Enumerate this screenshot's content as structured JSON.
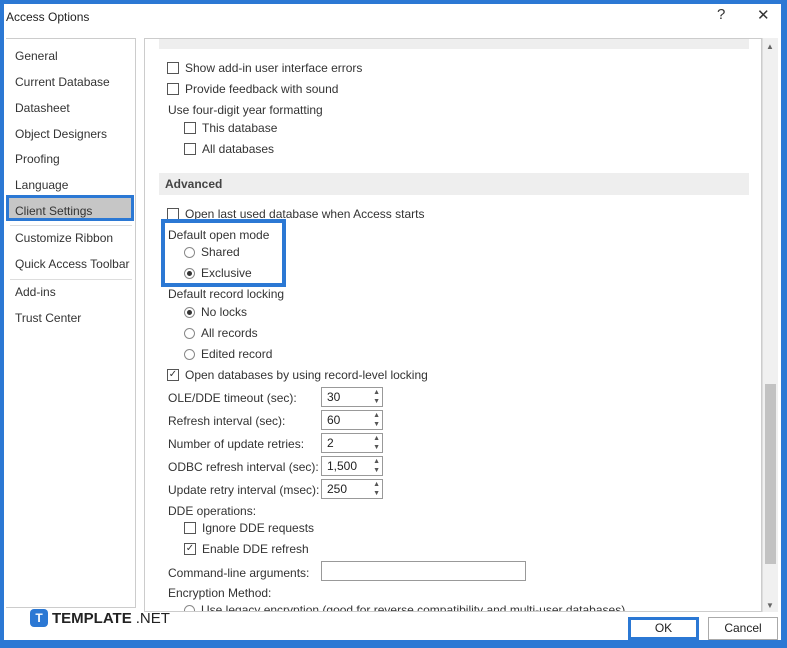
{
  "window": {
    "title": "Access Options",
    "help": "?",
    "close": "✕"
  },
  "sidebar": {
    "items": [
      "General",
      "Current Database",
      "Datasheet",
      "Object Designers",
      "Proofing",
      "Language",
      "Client Settings",
      "Customize Ribbon",
      "Quick Access Toolbar",
      "Add-ins",
      "Trust Center"
    ],
    "selected": "Client Settings"
  },
  "general": {
    "show_addin_errors": "Show add-in user interface errors",
    "feedback_sound": "Provide feedback with sound",
    "four_digit": "Use four-digit year formatting",
    "this_db": "This database",
    "all_db": "All databases"
  },
  "advanced": {
    "header": "Advanced",
    "open_last": "Open last used database when Access starts",
    "open_mode_label": "Default open mode",
    "shared": "Shared",
    "exclusive": "Exclusive",
    "open_mode_selected": "Exclusive",
    "record_locking_label": "Default record locking",
    "no_locks": "No locks",
    "all_records": "All records",
    "edited_record": "Edited record",
    "record_locking_selected": "No locks",
    "record_level": "Open databases by using record-level locking",
    "record_level_checked": true,
    "fields": [
      {
        "label": "OLE/DDE timeout (sec):",
        "value": "30"
      },
      {
        "label": "Refresh interval (sec):",
        "value": "60"
      },
      {
        "label": "Number of update retries:",
        "value": "2"
      },
      {
        "label": "ODBC refresh interval (sec):",
        "value": "1,500"
      },
      {
        "label": "Update retry interval (msec):",
        "value": "250"
      }
    ],
    "dde_label": "DDE operations:",
    "ignore_dde": "Ignore DDE requests",
    "enable_dde": "Enable DDE refresh",
    "enable_dde_checked": true,
    "cmdline_label": "Command-line arguments:",
    "cmdline_value": "",
    "encryption_label": "Encryption Method:",
    "legacy_enc": "Use legacy encryption (good for reverse compatibility and multi-user databases)"
  },
  "footer": {
    "ok": "OK",
    "cancel": "Cancel"
  },
  "watermark": {
    "brand": "TEMPLATE",
    "suffix": ".NET"
  },
  "colors": {
    "accent": "#2b78d4"
  }
}
